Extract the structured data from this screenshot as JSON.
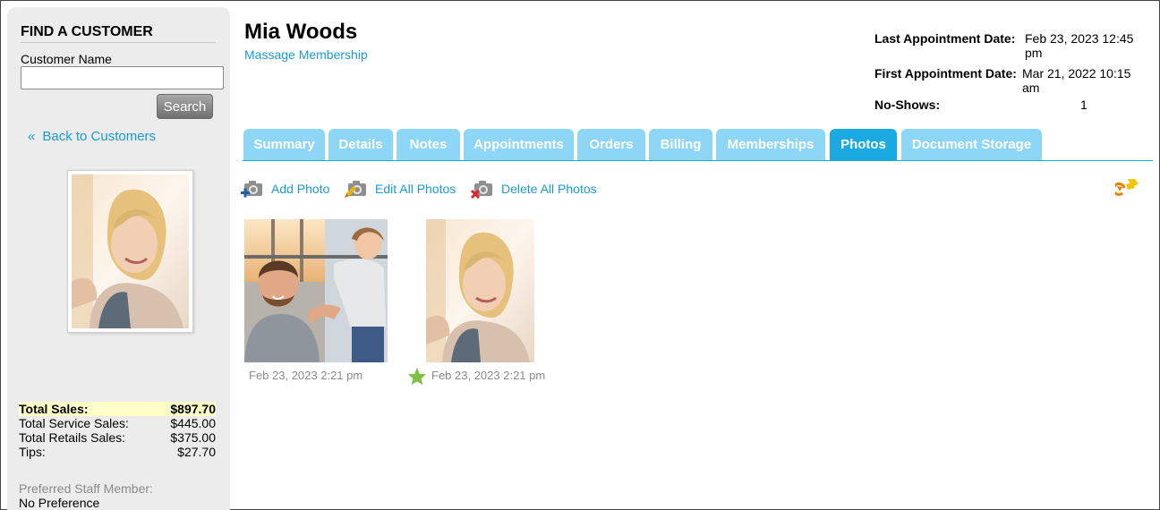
{
  "sidebar": {
    "find_title": "FIND A CUSTOMER",
    "customer_name_label": "Customer Name",
    "customer_name_value": "",
    "search_label": "Search",
    "back_chev": "«",
    "back_label": "Back to Customers",
    "totals": [
      {
        "label": "Total Sales:",
        "value": "$897.70"
      },
      {
        "label": "Total Service Sales:",
        "value": "$445.00"
      },
      {
        "label": "Total Retails Sales:",
        "value": "$375.00"
      },
      {
        "label": "Tips:",
        "value": "$27.70"
      }
    ],
    "preferred_label": "Preferred Staff Member:",
    "preferred_value": "No Preference"
  },
  "customer": {
    "name": "Mia Woods",
    "membership": "Massage Membership"
  },
  "appointments": {
    "last_label": "Last Appointment Date:",
    "last_value": "Feb 23, 2023 12:45 pm",
    "first_label": "First Appointment Date:",
    "first_value": "Mar 21, 2022 10:15 am",
    "noshows_label": "No-Shows:",
    "noshows_value": "1"
  },
  "tabs": [
    {
      "label": "Summary"
    },
    {
      "label": "Details"
    },
    {
      "label": "Notes"
    },
    {
      "label": "Appointments"
    },
    {
      "label": "Orders"
    },
    {
      "label": "Billing"
    },
    {
      "label": "Memberships"
    },
    {
      "label": "Photos",
      "active": true
    },
    {
      "label": "Document Storage"
    }
  ],
  "actions": {
    "add": "Add Photo",
    "edit": "Edit All Photos",
    "delete": "Delete All Photos"
  },
  "photos": [
    {
      "caption": "Feb 23, 2023 2:21 pm",
      "primary": false
    },
    {
      "caption": "Feb 23, 2023 2:21 pm",
      "primary": true
    }
  ],
  "colors": {
    "accent": "#1aa9e0",
    "tab_inactive": "#8dd6f5",
    "link": "#1a9bd7",
    "star": "#7dc243",
    "highlight": "#ffffc8"
  },
  "icons": [
    "camera-add-icon",
    "camera-edit-icon",
    "camera-delete-icon",
    "refresh-icon",
    "star-icon"
  ]
}
